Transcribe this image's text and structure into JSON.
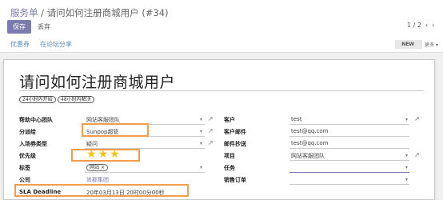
{
  "breadcrumb": {
    "parent": "服务单",
    "separator": "/",
    "current": "请问如何注册商城用户 (#34)"
  },
  "buttons": {
    "save": "保存",
    "discard": "丢弃"
  },
  "pager": {
    "position": "1 / 2",
    "prev": "‹",
    "next": "›"
  },
  "actions": {
    "coupon": "优惠券",
    "share": "在论坛分享"
  },
  "status": {
    "label": "NEW",
    "more": "更多 ▾"
  },
  "ticket": {
    "title": "请问如何注册商城用户",
    "tags": [
      "24小时内开始",
      "48小时内解决"
    ]
  },
  "left_fields": {
    "team": {
      "label": "帮助中心团队",
      "value": "网站客服团队"
    },
    "assigned": {
      "label": "分派给",
      "value": "Sunpop超管"
    },
    "type": {
      "label": "入场券类型",
      "value": "疑问"
    },
    "priority": {
      "label": "优先级",
      "stars": 3
    },
    "tags": {
      "label": "标签",
      "value": "网站"
    },
    "company": {
      "label": "公司",
      "value": "尚郡集团"
    },
    "sla": {
      "label": "SLA Deadline",
      "value": "20年03月13日 20时00分00秒"
    }
  },
  "right_fields": {
    "customer": {
      "label": "客户",
      "value": "test"
    },
    "customer_email": {
      "label": "客户邮件",
      "value": "test@qq.com"
    },
    "cc_email": {
      "label": "邮件抄送",
      "value": "test@qq.com"
    },
    "project": {
      "label": "项目",
      "value": "网站客服团队"
    },
    "task": {
      "label": "任务",
      "value": ""
    },
    "sale_order": {
      "label": "销售订单",
      "value": ""
    }
  },
  "icons": {
    "external": "↗",
    "caret": "▾",
    "star": "★",
    "remove": "×"
  },
  "colors": {
    "accent": "#7c7bad",
    "highlight": "#f39c4a",
    "star": "#f0c419"
  }
}
